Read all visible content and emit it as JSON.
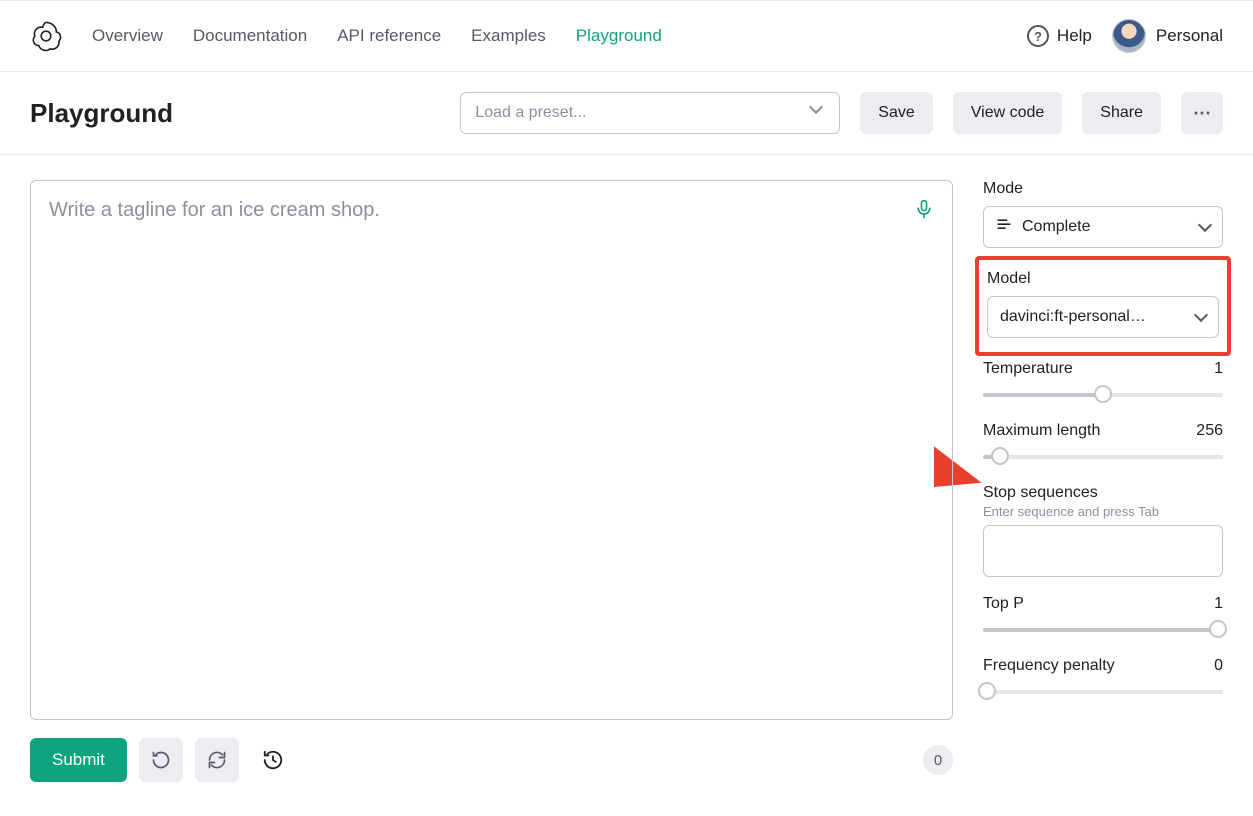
{
  "nav": {
    "items": [
      "Overview",
      "Documentation",
      "API reference",
      "Examples",
      "Playground"
    ],
    "active": "Playground"
  },
  "top_right": {
    "help": "Help",
    "account": "Personal"
  },
  "header": {
    "title": "Playground",
    "preset_placeholder": "Load a preset...",
    "save": "Save",
    "view_code": "View code",
    "share": "Share",
    "more": "⋯"
  },
  "editor": {
    "placeholder": "Write a tagline for an ice cream shop.",
    "submit": "Submit",
    "token_count": "0"
  },
  "sidebar": {
    "mode_label": "Mode",
    "mode_value": "Complete",
    "model_label": "Model",
    "model_value": "davinci:ft-personal…",
    "temperature_label": "Temperature",
    "temperature_value": "1",
    "maxlen_label": "Maximum length",
    "maxlen_value": "256",
    "stop_label": "Stop sequences",
    "stop_hint": "Enter sequence and press Tab",
    "topp_label": "Top P",
    "topp_value": "1",
    "freq_label": "Frequency penalty",
    "freq_value": "0"
  }
}
